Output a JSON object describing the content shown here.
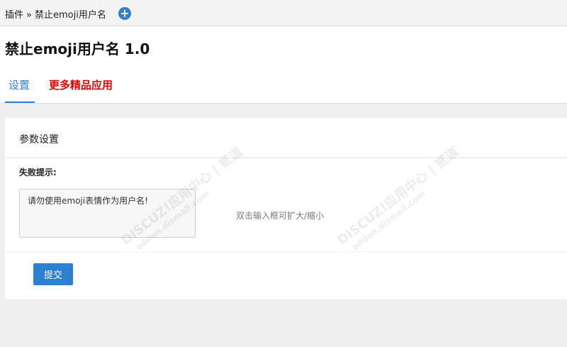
{
  "breadcrumb": {
    "root": "插件",
    "separator": "»",
    "current": "禁止emoji用户名"
  },
  "header": {
    "title": "禁止emoji用户名 1.0"
  },
  "tabs": {
    "settings": "设置",
    "more_apps": "更多精品应用"
  },
  "panel": {
    "title": "参数设置",
    "field_label": "失败提示:",
    "field_value": "请勿使用emoji表情作为用户名!",
    "hint": "双击输入框可扩大/缩小",
    "submit_label": "提交"
  },
  "watermark": {
    "text": "DISCUZ!应用中心 | 贰道",
    "sub": "addon.dismall.com"
  },
  "colors": {
    "accent": "#2d7fd2",
    "highlight": "#e00000"
  }
}
